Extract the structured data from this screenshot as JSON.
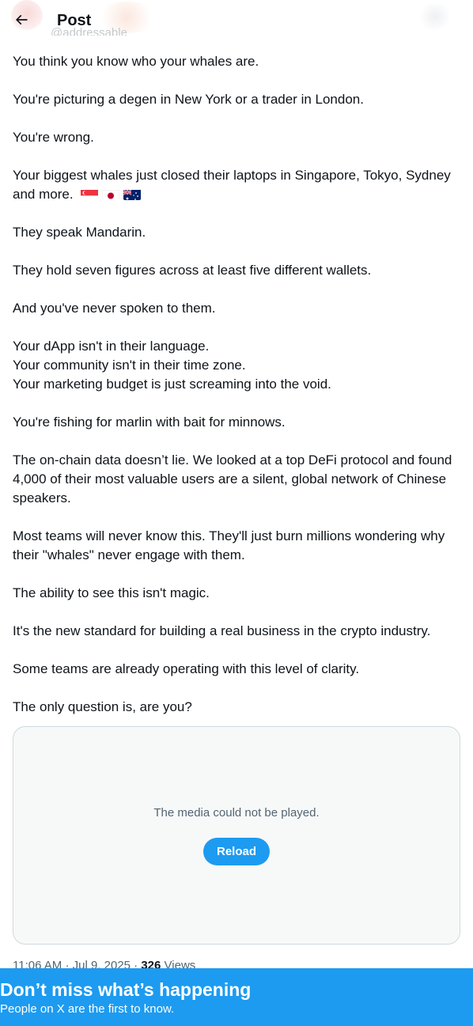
{
  "header": {
    "title": "Post",
    "back_icon": "arrow-left-icon",
    "author_handle_fragment": "@addressable"
  },
  "post": {
    "paragraphs": [
      "You think you know who your whales are.",
      "You're picturing a degen in New York or a trader in London.",
      "You're wrong.",
      "Your biggest whales just closed their laptops in Singapore, Tokyo, Sydney and more.",
      "They speak Mandarin.",
      "They hold seven figures across at least five different wallets.",
      "And you've never spoken to them.",
      "Your dApp isn't in their language.",
      "Your community isn't in their time zone.",
      "Your marketing budget is just screaming into the void.",
      "You're fishing for marlin with bait for minnows.",
      "The on-chain data doesn’t lie. We looked at a top DeFi protocol and found 4,000 of their most valuable users are a silent, global network of Chinese speakers.",
      "Most teams will never know this. They'll just burn millions wondering why their \"whales\" never engage with them.",
      "The ability to see this isn't magic.",
      "It's the new standard for building a real business in the crypto industry.",
      "Some teams are already operating with this level of clarity.",
      "The only question is, are you?"
    ],
    "flags": [
      "flag-singapore-icon",
      "flag-japan-icon",
      "flag-australia-icon"
    ]
  },
  "media": {
    "error_message": "The media could not be played.",
    "reload_label": "Reload"
  },
  "meta": {
    "time": "11:06 AM",
    "separator": "·",
    "date": "Jul 9, 2025",
    "views_count": "326",
    "views_label": "Views"
  },
  "banner": {
    "title": "Don’t miss what’s happening",
    "subtitle": "People on X are the first to know."
  },
  "colors": {
    "accent": "#1d9bf0",
    "text": "#0f1419",
    "muted": "#536471",
    "border": "#cfd9de"
  }
}
